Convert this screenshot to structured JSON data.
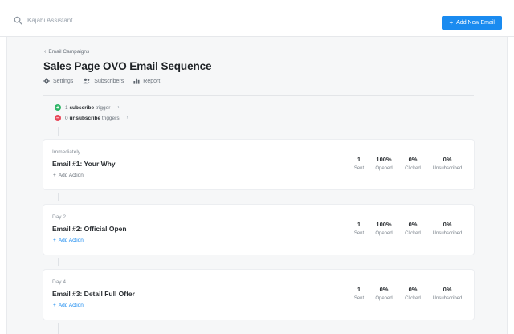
{
  "search": {
    "placeholder": "Kajabi Assistant"
  },
  "header": {
    "add_button_label": "Add New Email",
    "add_button_color": "#1a8bf0"
  },
  "breadcrumb": {
    "back_label": "Email Campaigns"
  },
  "page": {
    "title": "Sales Page OVO Email Sequence"
  },
  "tabs": [
    {
      "label": "Settings",
      "icon": "gear-icon"
    },
    {
      "label": "Subscribers",
      "icon": "users-icon"
    },
    {
      "label": "Report",
      "icon": "bar-chart-icon"
    }
  ],
  "triggers": {
    "subscribe": {
      "count": "1",
      "bold": "subscribe",
      "rest": "trigger",
      "color": "#2fb567"
    },
    "unsubscribe": {
      "count": "0",
      "bold": "unsubscribe",
      "rest": "triggers",
      "color": "#e8485a"
    }
  },
  "emails": [
    {
      "when": "Immediately",
      "name": "Email #1: Your Why",
      "add_action": "Add Action",
      "stats": [
        {
          "value": "1",
          "label": "Sent"
        },
        {
          "value": "100%",
          "label": "Opened"
        },
        {
          "value": "0%",
          "label": "Clicked"
        },
        {
          "value": "0%",
          "label": "Unsubscribed"
        }
      ]
    },
    {
      "when": "Day 2",
      "name": "Email #2: Official Open",
      "add_action": "Add Action",
      "stats": [
        {
          "value": "1",
          "label": "Sent"
        },
        {
          "value": "100%",
          "label": "Opened"
        },
        {
          "value": "0%",
          "label": "Clicked"
        },
        {
          "value": "0%",
          "label": "Unsubscribed"
        }
      ]
    },
    {
      "when": "Day 4",
      "name": "Email #3: Detail Full Offer",
      "add_action": "Add Action",
      "stats": [
        {
          "value": "1",
          "label": "Sent"
        },
        {
          "value": "0%",
          "label": "Opened"
        },
        {
          "value": "0%",
          "label": "Clicked"
        },
        {
          "value": "0%",
          "label": "Unsubscribed"
        }
      ]
    }
  ]
}
